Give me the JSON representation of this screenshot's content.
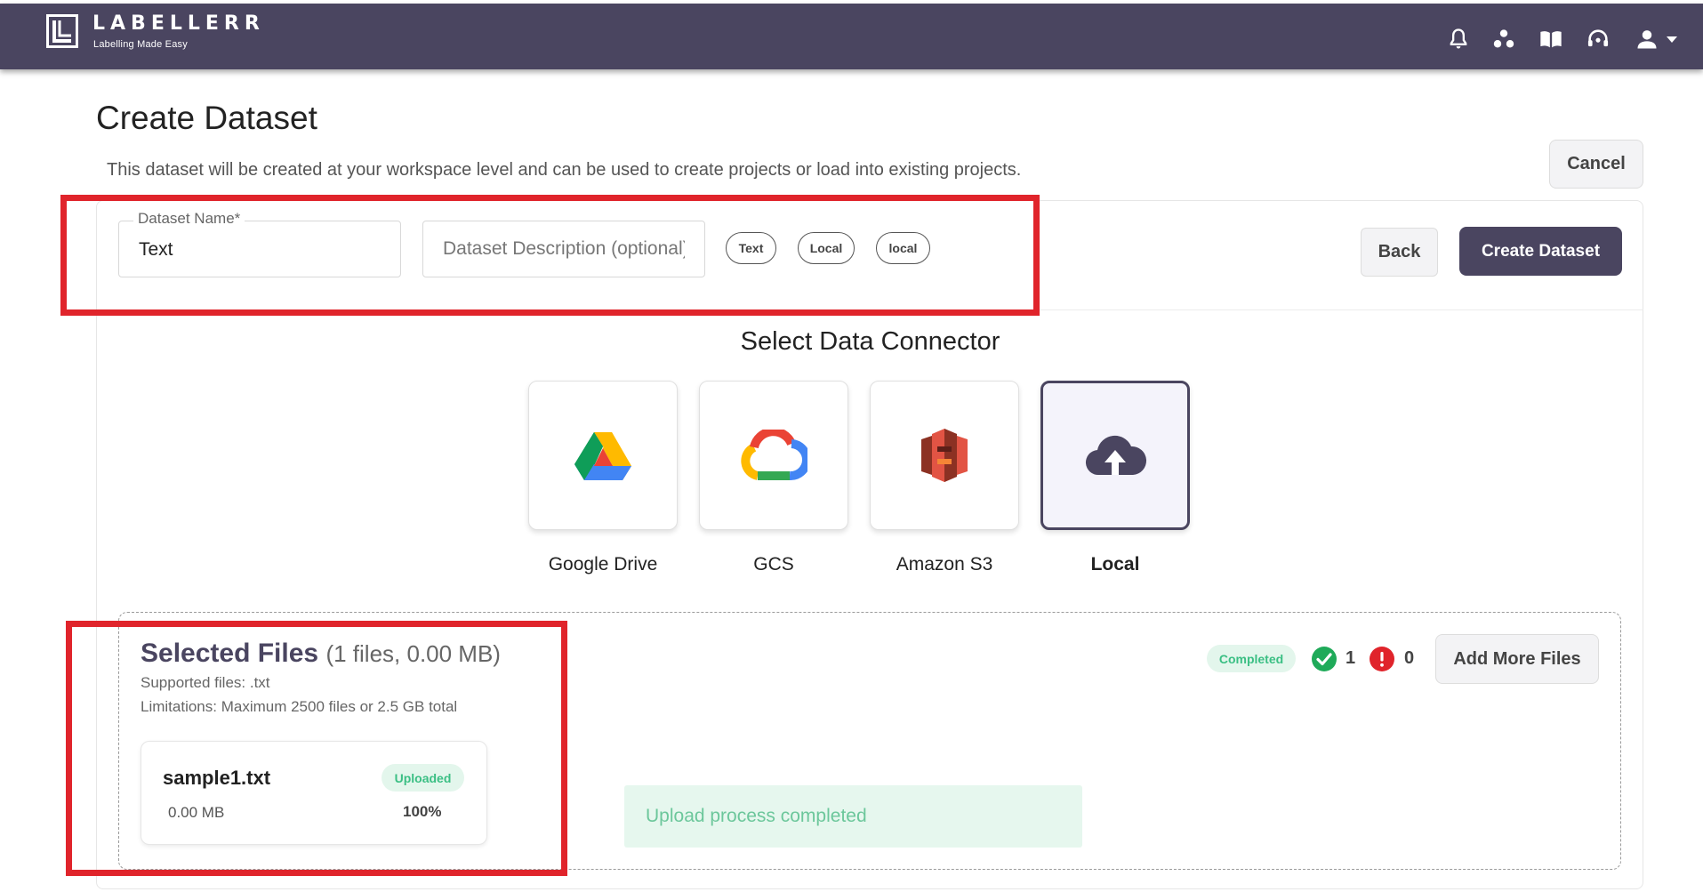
{
  "header": {
    "brand": "LABELLERR",
    "tagline": "Labelling Made Easy",
    "icons": [
      "bell-icon",
      "users-icon",
      "book-icon",
      "headset-icon",
      "user-icon",
      "caret-down-icon"
    ]
  },
  "page": {
    "title": "Create Dataset",
    "subtitle": "This dataset will be created at your workspace level and can be used to create projects or load into existing projects.",
    "cancel_label": "Cancel"
  },
  "form": {
    "name_label": "Dataset Name*",
    "name_value": "Text",
    "description_placeholder": "Dataset Description (optional)",
    "tags": [
      "Text",
      "Local",
      "local"
    ],
    "back_label": "Back",
    "create_label": "Create Dataset"
  },
  "connectors": {
    "title": "Select Data Connector",
    "items": [
      {
        "label": "Google Drive",
        "icon": "google-drive-icon",
        "active": false
      },
      {
        "label": "GCS",
        "icon": "gcs-cloud-icon",
        "active": false
      },
      {
        "label": "Amazon S3",
        "icon": "amazon-s3-icon",
        "active": false
      },
      {
        "label": "Local",
        "icon": "cloud-upload-icon",
        "active": true
      }
    ]
  },
  "files": {
    "title": "Selected Files",
    "count_text": "(1 files, 0.00 MB)",
    "supported": "Supported files: .txt",
    "limitations": "Limitations: Maximum 2500 files or 2.5 GB total",
    "status_badge": "Completed",
    "success_count": "1",
    "error_count": "0",
    "add_more_label": "Add More Files",
    "list": [
      {
        "name": "sample1.txt",
        "size": "0.00 MB",
        "status": "Uploaded",
        "progress": "100%"
      }
    ],
    "message": "Upload process completed"
  },
  "colors": {
    "primary": "#4a4560",
    "success": "#3bbf84",
    "error": "#e0242b",
    "highlight": "#e0242b"
  }
}
